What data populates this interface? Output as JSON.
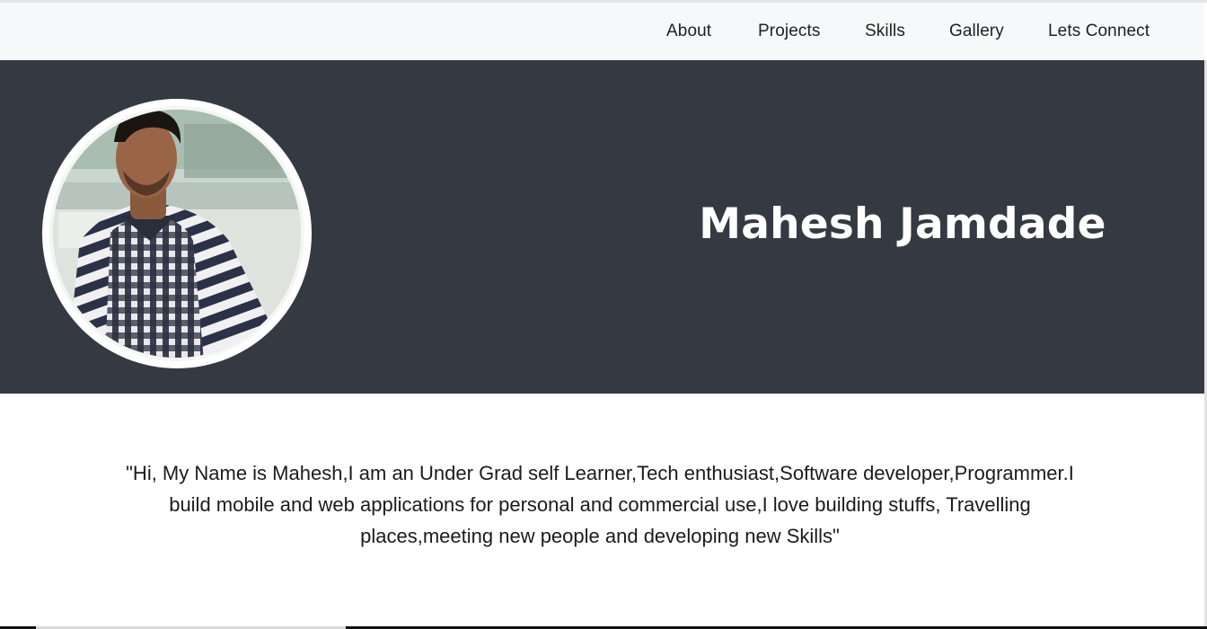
{
  "nav": {
    "items": [
      {
        "label": "About"
      },
      {
        "label": "Projects"
      },
      {
        "label": "Skills"
      },
      {
        "label": "Gallery"
      },
      {
        "label": "Lets Connect"
      }
    ]
  },
  "hero": {
    "name": "Mahesh Jamdade",
    "background_color": "#353a42"
  },
  "about": {
    "bio": "\"Hi, My Name is Mahesh,I am an Under Grad self Learner,Tech enthusiast,Software developer,Programmer.I build mobile and web applications for personal and commercial use,I love building stuffs, Travelling places,meeting new people and developing new Skills\""
  }
}
